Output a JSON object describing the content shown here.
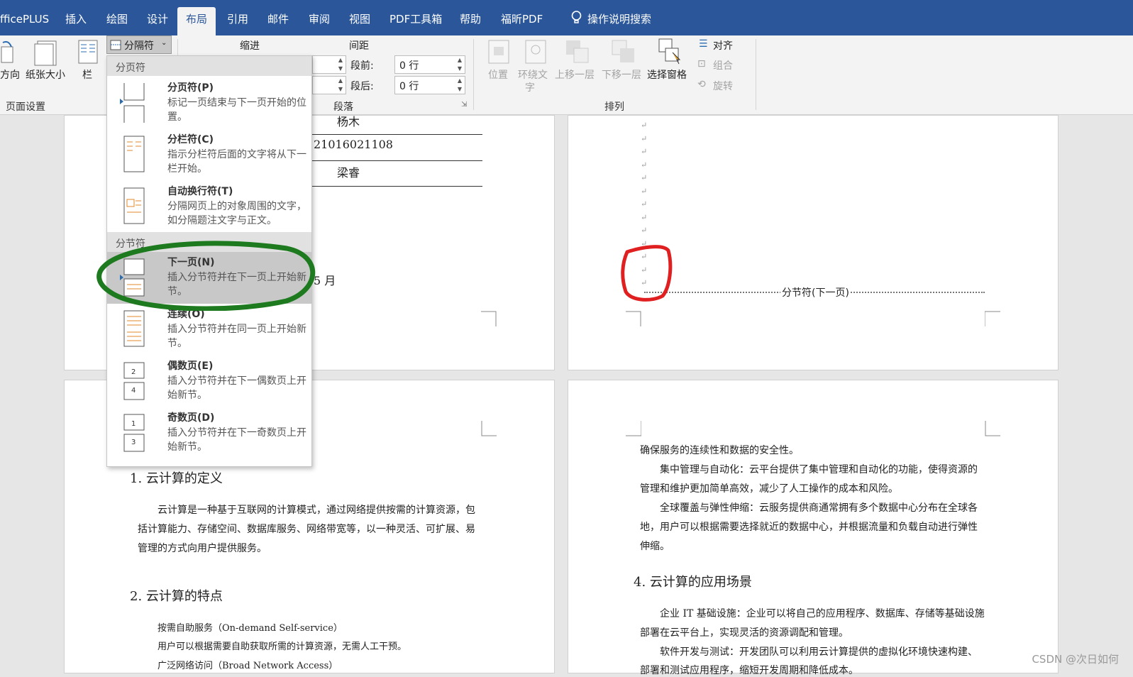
{
  "tabs": [
    "fficePLUS",
    "插入",
    "绘图",
    "设计",
    "布局",
    "引用",
    "邮件",
    "审阅",
    "视图",
    "PDF工具箱",
    "帮助",
    "福昕PDF",
    "操作说明搜索"
  ],
  "ribbon": {
    "orientation": "方向",
    "size": "纸张大小",
    "columns": "栏",
    "breaks": "分隔符",
    "page_setup": "页面设置",
    "indent": "缩进",
    "spacing": "间距",
    "before_label": "段前:",
    "before_value": "0 行",
    "after_label": "段后:",
    "after_value": "0 行",
    "paragraph": "段落",
    "position": "位置",
    "wrap": "环绕文",
    "wrap2": "字",
    "forward": "上移一层",
    "backward": "下移一层",
    "pane": "选择窗格",
    "align": "对齐",
    "group": "组合",
    "rotate": "旋转",
    "arrange": "排列"
  },
  "menu": {
    "page_breaks": "分页符",
    "section_breaks": "分节符",
    "items": [
      {
        "title": "分页符(P)",
        "desc": "标记一页结束与下一页开始的位置。"
      },
      {
        "title": "分栏符(C)",
        "desc": "指示分栏符后面的文字将从下一栏开始。"
      },
      {
        "title": "自动换行符(T)",
        "desc": "分隔网页上的对象周围的文字，如分隔题注文字与正文。"
      },
      {
        "title": "下一页(N)",
        "desc": "插入分节符并在下一页上开始新节。"
      },
      {
        "title": "连续(O)",
        "desc": "插入分节符并在同一页上开始新节。"
      },
      {
        "title": "偶数页(E)",
        "desc": "插入分节符并在下一偶数页上开始新节。"
      },
      {
        "title": "奇数页(D)",
        "desc": "插入分节符并在下一奇数页上开始新节。"
      }
    ]
  },
  "doc": {
    "name": "杨木",
    "id": "21016021108",
    "teacher": "梁睿",
    "month": "5 月",
    "section_break": "分节符(下一页)",
    "h1": "1.  云计算的定义",
    "p1": [
      "云计算是一种基于互联网的计算模式，通过网络提供按需的计算资源，包",
      "括计算能力、存储空间、数据库服务、网络带宽等，以一种灵活、可扩展、易",
      "管理的方式向用户提供服务。"
    ],
    "h2": "2.  云计算的特点",
    "p2": [
      "按需自助服务（On-demand Self-service）",
      "用户可以根据需要自助获取所需的计算资源，无需人工干预。",
      "广泛网络访问（Broad Network Access）"
    ],
    "p3": [
      "确保服务的连续性和数据的安全性。",
      "集中管理与自动化：云平台提供了集中管理和自动化的功能，使得资源的",
      "管理和维护更加简单高效，减少了人工操作的成本和风险。",
      "全球覆盖与弹性伸缩：云服务提供商通常拥有多个数据中心分布在全球各",
      "地，用户可以根据需要选择就近的数据中心，并根据流量和负载自动进行弹性",
      "伸缩。"
    ],
    "h4": "4.  云计算的应用场景",
    "p4": [
      "企业 IT 基础设施：企业可以将自己的应用程序、数据库、存储等基础设施",
      "部署在云平台上，实现灵活的资源调配和管理。",
      "软件开发与测试：开发团队可以利用云计算提供的虚拟化环境快速构建、",
      "部署和测试应用程序，缩短开发周期和降低成本。"
    ]
  },
  "watermark": "CSDN @次日如何",
  "colors": {
    "ribbon_blue": "#2b579a",
    "highlight_green": "#1e7a1e",
    "mark_red": "#e02020"
  }
}
